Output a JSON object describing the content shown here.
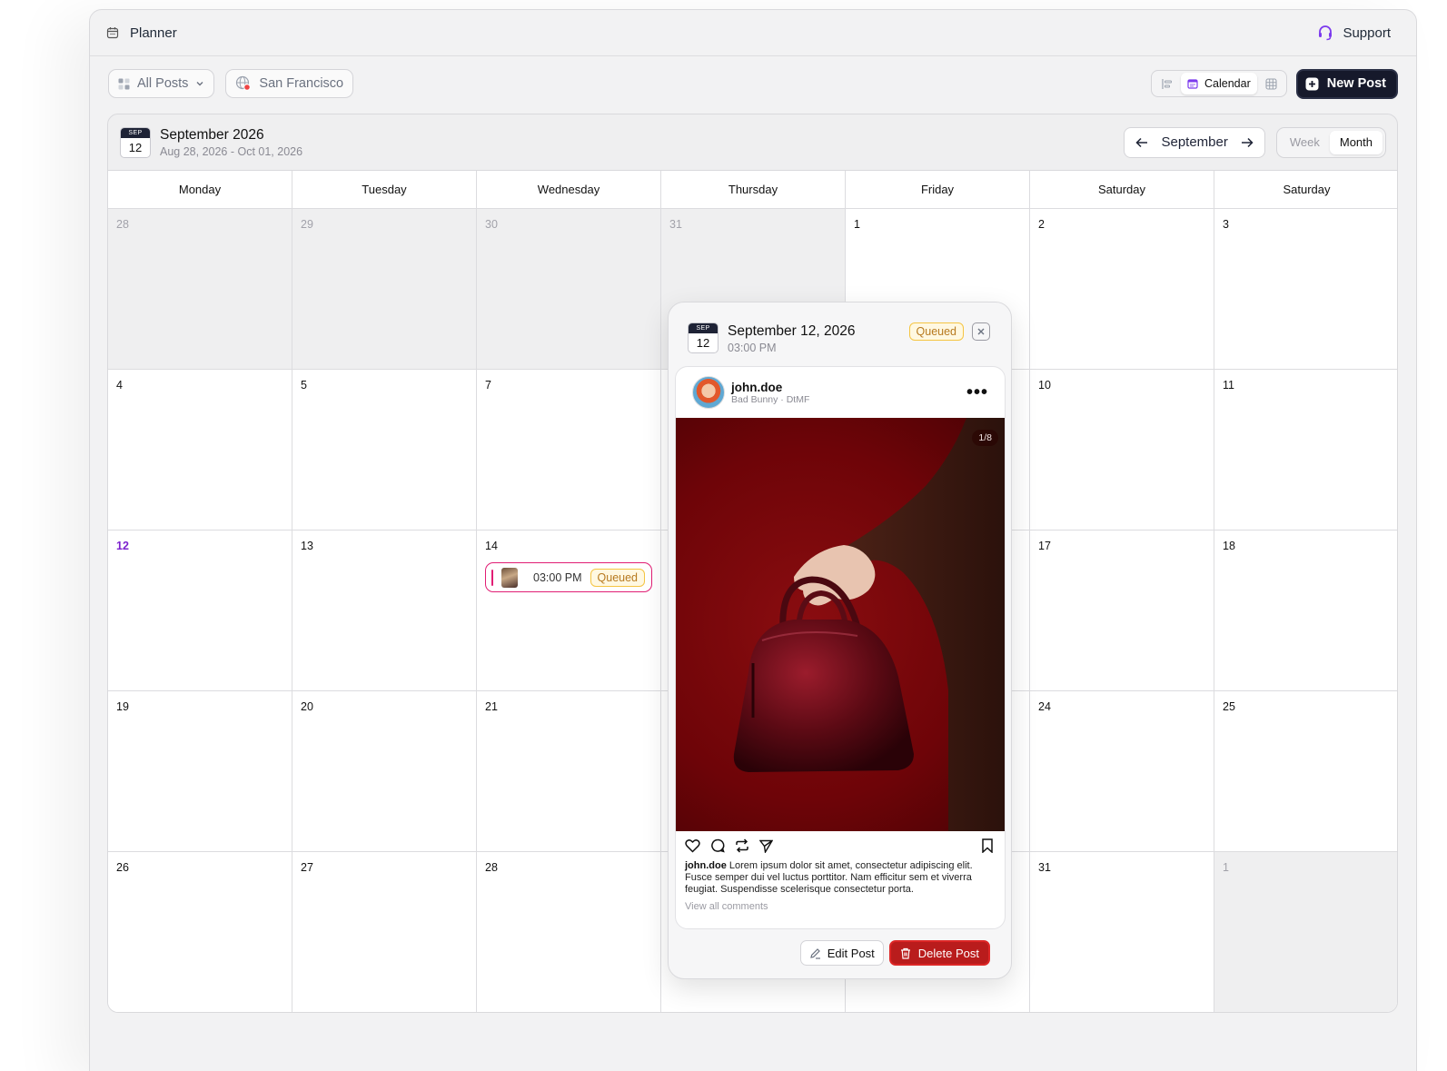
{
  "topbar": {
    "app_title": "Planner",
    "support_label": "Support"
  },
  "toolbar": {
    "filter_posts": "All Posts",
    "filter_location": "San Francisco",
    "view_calendar_label": "Calendar",
    "new_post_label": "New Post"
  },
  "calendar": {
    "badge_month": "SEP",
    "badge_day": "12",
    "title": "September 2026",
    "range": "Aug 28, 2026 - Oct 01, 2026",
    "nav_month": "September",
    "view_week": "Week",
    "view_month": "Month",
    "day_headers": [
      "Monday",
      "Tuesday",
      "Wednesday",
      "Thursday",
      "Friday",
      "Saturday",
      "Saturday"
    ],
    "weeks": [
      [
        "28",
        "29",
        "30",
        "31",
        "1",
        "2",
        "3"
      ],
      [
        "4",
        "5",
        "7",
        "",
        "",
        "10",
        "11"
      ],
      [
        "12",
        "13",
        "14",
        "",
        "",
        "17",
        "18"
      ],
      [
        "19",
        "20",
        "21",
        "",
        "",
        "24",
        "25"
      ],
      [
        "26",
        "27",
        "28",
        "",
        "",
        "31",
        "1"
      ]
    ],
    "event": {
      "time": "03:00 PM",
      "status": "Queued"
    }
  },
  "popup": {
    "badge_month": "SEP",
    "badge_day": "12",
    "date": "September 12, 2026",
    "time": "03:00 PM",
    "status": "Queued",
    "post": {
      "username": "john.doe",
      "subtitle": "Bad Bunny · DtMF",
      "counter": "1/8",
      "caption_user": "john.doe",
      "caption_text": " Lorem ipsum dolor sit amet, consectetur adipiscing elit. Fusce semper dui vel luctus porttitor. Nam efficitur sem et viverra feugiat. Suspendisse scelerisque consectetur porta.",
      "view_comments": "View all comments"
    },
    "edit_label": "Edit Post",
    "delete_label": "Delete Post"
  },
  "colors": {
    "accent_purple": "#7c22ce",
    "queued_border": "#f5c542",
    "delete_red": "#b91c1c",
    "event_pink": "#e11d74",
    "navy": "#16192b"
  }
}
